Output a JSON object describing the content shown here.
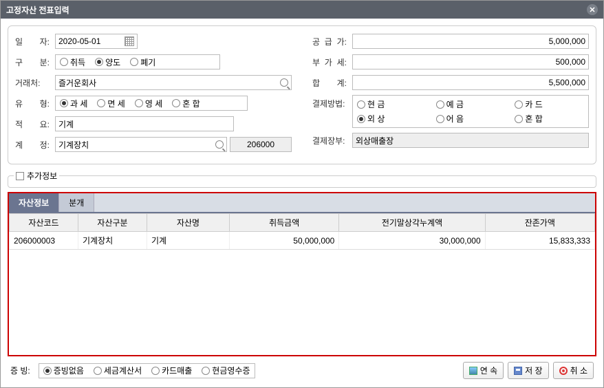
{
  "title": "고정자산 전표입력",
  "left": {
    "date_label": "일   자:",
    "date_value": "2020-05-01",
    "class_label": "구   분:",
    "class_options": [
      "취득",
      "양도",
      "폐기"
    ],
    "class_selected": 1,
    "vendor_label": "거래처:",
    "vendor_value": "즐거운회사",
    "type_label": "유   형:",
    "type_options": [
      "과 세",
      "면 세",
      "영 세",
      "혼 합"
    ],
    "type_selected": 0,
    "memo_label": "적   요:",
    "memo_value": "기계",
    "acct_label": "계   정:",
    "acct_name": "기계장치",
    "acct_code": "206000"
  },
  "right": {
    "supply_label": "공 급 가:",
    "supply_value": "5,000,000",
    "vat_label": "부 가 세:",
    "vat_value": "500,000",
    "total_label": "합     계:",
    "total_value": "5,500,000",
    "paymethod_label": "결제방법:",
    "pay_options": [
      "현 금",
      "예 금",
      "카 드",
      "외 상",
      "어 음",
      "혼 합"
    ],
    "pay_selected": 3,
    "paybook_label": "결제장부:",
    "paybook_value": "외상매출장"
  },
  "extra_label": "추가정보",
  "tabs": [
    "자산정보",
    "분개"
  ],
  "active_tab": 0,
  "grid": {
    "headers": [
      "자산코드",
      "자산구분",
      "자산명",
      "취득금액",
      "전기말상각누계액",
      "잔존가액"
    ],
    "row": {
      "code": "206000003",
      "kind": "기계장치",
      "name": "기계",
      "acq": "50,000,000",
      "dep": "30,000,000",
      "rem": "15,833,333"
    }
  },
  "footer": {
    "evidence_label": "증   빙:",
    "evidence_options": [
      "증빙없음",
      "세금계산서",
      "카드매출",
      "현금영수증"
    ],
    "evidence_selected": 0,
    "btn_continue": "연 속",
    "btn_save": "저 장",
    "btn_cancel": "취 소"
  }
}
